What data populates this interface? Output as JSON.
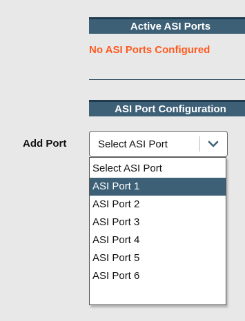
{
  "active_section": {
    "title": "Active ASI Ports",
    "status_text": "No ASI Ports Configured"
  },
  "config_section": {
    "title": "ASI Port Configuration",
    "add_port_label": "Add Port",
    "select": {
      "value": "Select ASI Port",
      "chevron_icon": "chevron-down-icon"
    },
    "options": [
      "Select ASI Port",
      "ASI Port 1",
      "ASI Port 2",
      "ASI Port 3",
      "ASI Port 4",
      "ASI Port 5",
      "ASI Port 6"
    ],
    "highlighted_option": "ASI Port 1"
  },
  "colors": {
    "header_bg": "#3d6077",
    "warning_text": "#ff5a1f",
    "page_bg": "#e8e8e8"
  }
}
